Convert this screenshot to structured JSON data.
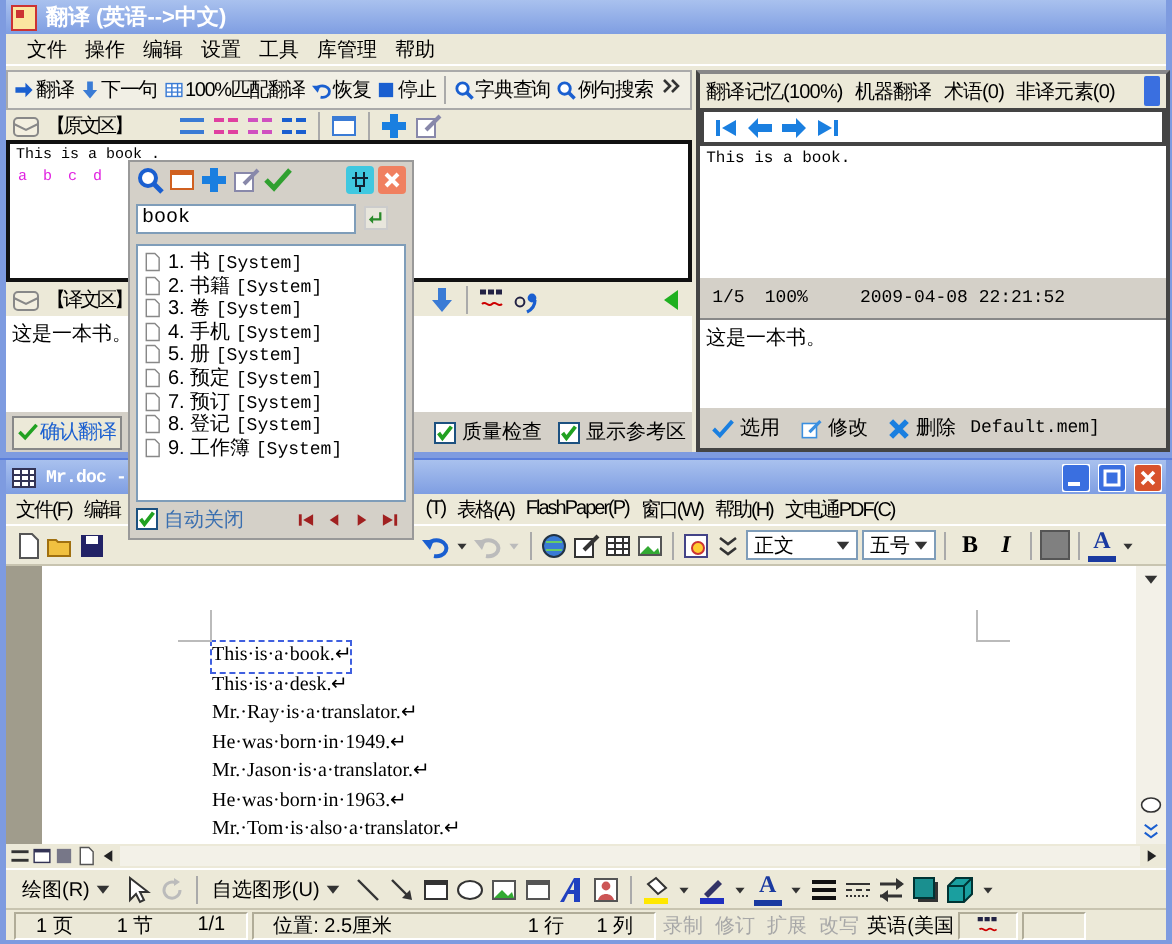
{
  "translator": {
    "title": "翻译 (英语-->中文)",
    "menu": [
      "文件",
      "操作",
      "编辑",
      "设置",
      "工具",
      "库管理",
      "帮助"
    ],
    "toolbar": [
      [
        "翻译",
        "下一句",
        "100%匹配翻译",
        "恢复",
        "停止"
      ],
      [
        "字典查询",
        "例句搜索"
      ]
    ],
    "source": {
      "header": "【原文区】",
      "text": "This is a book .",
      "marks": [
        "a",
        "b",
        "c",
        "d"
      ]
    },
    "target": {
      "header": "【译文区】",
      "text": "这是一本书。",
      "confirm_button": "确认翻译",
      "options": [
        {
          "label": "质量检查",
          "checked": true
        },
        {
          "label": "显示参考区",
          "checked": true
        }
      ]
    },
    "reference": {
      "tabs": [
        "翻译记忆(100%)",
        "机器翻译",
        "术语(0)",
        "非译元素(0)"
      ],
      "source_text": "This is a book.",
      "match": {
        "index": "1/5",
        "score": "100%",
        "date": "2009-04-08 22:21:52"
      },
      "target_text": "这是一本书。",
      "actions": [
        "选用",
        "修改",
        "删除"
      ],
      "memory": "Default.mem]"
    }
  },
  "lookup": {
    "query": "book",
    "results": [
      {
        "number": "1.",
        "term": "书",
        "source": "[System]"
      },
      {
        "number": "2.",
        "term": "书籍",
        "source": "[System]"
      },
      {
        "number": "3.",
        "term": "卷",
        "source": "[System]"
      },
      {
        "number": "4.",
        "term": "手机",
        "source": "[System]"
      },
      {
        "number": "5.",
        "term": "册",
        "source": "[System]"
      },
      {
        "number": "6.",
        "term": "预定",
        "source": "[System]"
      },
      {
        "number": "7.",
        "term": "预订",
        "source": "[System]"
      },
      {
        "number": "8.",
        "term": "登记",
        "source": "[System]"
      },
      {
        "number": "9.",
        "term": "工作簿",
        "source": "[System]"
      }
    ],
    "auto_close": {
      "label": "自动关闭",
      "checked": true
    }
  },
  "word": {
    "title": "Mr.doc -",
    "menu": [
      "文件(F)",
      "编辑",
      "(T)",
      "表格(A)",
      "FlashPaper(P)",
      "窗口(W)",
      "帮助(H)",
      "文电通PDF(C)"
    ],
    "style": "正文",
    "font_size": "五号",
    "format_buttons": [
      "B",
      "I"
    ],
    "font_color": "A",
    "lines": [
      {
        "text": "This·is·a·book.↵",
        "current": true
      },
      {
        "text": "This·is·a·desk.↵",
        "current": false
      },
      {
        "text": "Mr.·Ray·is·a·translator.↵",
        "current": false
      },
      {
        "text": "He·was·born·in·1949.↵",
        "current": false
      },
      {
        "text": "Mr.·Jason·is·a·translator.↵",
        "current": false
      },
      {
        "text": "He·was·born·in·1963.↵",
        "current": false
      },
      {
        "text": "Mr.·Tom·is·also·a·translator.↵",
        "current": false
      }
    ],
    "drawing": {
      "draw_menu": "绘图(R)",
      "shapes_menu": "自选图形(U)",
      "font_color": "A"
    },
    "status": [
      "1 页",
      "1 节",
      "1/1",
      "位置: 2.5厘米",
      "1 行",
      "1 列"
    ],
    "flags": [
      {
        "label": "录制",
        "disabled": true
      },
      {
        "label": "修订",
        "disabled": true
      },
      {
        "label": "扩展",
        "disabled": true
      },
      {
        "label": "改写",
        "disabled": true
      }
    ],
    "language": "英语(美国"
  }
}
